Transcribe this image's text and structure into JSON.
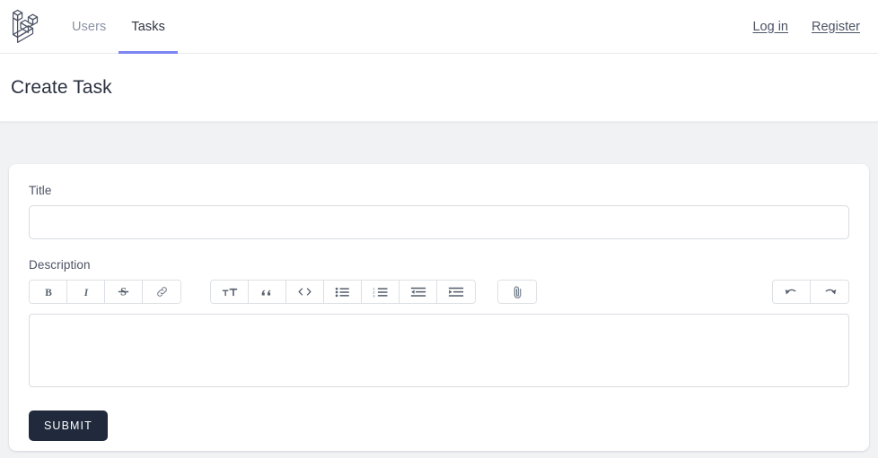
{
  "theme": {
    "accent": "#7b86f0",
    "page_bg": "#f1f2f4",
    "card_bg": "#ffffff",
    "submit_bg": "#202a3c",
    "text_dark": "#2b3040",
    "text_muted": "#8b93a5"
  },
  "navbar": {
    "brand_icon": "laravel-logo-icon",
    "links": [
      {
        "label": "Users",
        "active": false
      },
      {
        "label": "Tasks",
        "active": true
      }
    ],
    "auth": [
      {
        "label": "Log in"
      },
      {
        "label": "Register"
      }
    ]
  },
  "header": {
    "title": "Create Task"
  },
  "form": {
    "title_field": {
      "label": "Title",
      "value": "",
      "placeholder": ""
    },
    "description_field": {
      "label": "Description",
      "value": "",
      "placeholder": ""
    },
    "submit_label": "SUBMIT"
  },
  "toolbar": {
    "groups": [
      {
        "name": "text-style",
        "buttons": [
          {
            "icon": "bold-icon",
            "title": "Bold"
          },
          {
            "icon": "italic-icon",
            "title": "Italic"
          },
          {
            "icon": "strikethrough-icon",
            "title": "Strikethrough"
          },
          {
            "icon": "link-icon",
            "title": "Link"
          }
        ]
      },
      {
        "name": "block-style",
        "buttons": [
          {
            "icon": "heading-icon",
            "title": "Heading"
          },
          {
            "icon": "quote-icon",
            "title": "Quote"
          },
          {
            "icon": "code-icon",
            "title": "Code"
          },
          {
            "icon": "bullet-list-icon",
            "title": "Bulleted List"
          },
          {
            "icon": "numbered-list-icon",
            "title": "Numbered List"
          },
          {
            "icon": "outdent-icon",
            "title": "Decrease Level"
          },
          {
            "icon": "indent-icon",
            "title": "Increase Level"
          }
        ]
      },
      {
        "name": "attachment",
        "buttons": [
          {
            "icon": "paperclip-icon",
            "title": "Attach Files"
          }
        ]
      },
      {
        "name": "history",
        "buttons": [
          {
            "icon": "undo-icon",
            "title": "Undo"
          },
          {
            "icon": "redo-icon",
            "title": "Redo"
          }
        ]
      }
    ]
  }
}
